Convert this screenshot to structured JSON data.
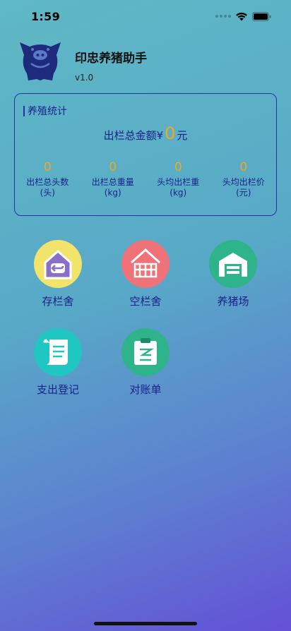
{
  "status_bar": {
    "time": "1:59"
  },
  "header": {
    "title": "印忠养猪助手",
    "version": "v1.0"
  },
  "stats": {
    "title": "养殖统计",
    "total_label": "出栏总金额¥",
    "total_value": "0",
    "total_unit": "元",
    "metrics": [
      {
        "value": "0",
        "label_line1": "出栏总头数",
        "label_line2": "(头)"
      },
      {
        "value": "0",
        "label_line1": "出栏总重量",
        "label_line2": "(kg)"
      },
      {
        "value": "0",
        "label_line1": "头均出栏重",
        "label_line2": "(kg)"
      },
      {
        "value": "0",
        "label_line1": "头均出栏价",
        "label_line2": "(元)"
      }
    ]
  },
  "functions": [
    {
      "label": "存栏舍",
      "icon": "occupied-pen-icon",
      "color": "#f2e36a"
    },
    {
      "label": "空栏舍",
      "icon": "empty-pen-icon",
      "color": "#ee7277"
    },
    {
      "label": "养猪场",
      "icon": "pig-farm-icon",
      "color": "#2fb38a"
    },
    {
      "label": "支出登记",
      "icon": "expense-scroll-icon",
      "color": "#1fc6c2"
    },
    {
      "label": "对账单",
      "icon": "statement-clipboard-icon",
      "color": "#2fb38a"
    }
  ],
  "colors": {
    "accent": "#f2a81d",
    "text": "#1a1f8a",
    "border": "#2a2fa8"
  }
}
